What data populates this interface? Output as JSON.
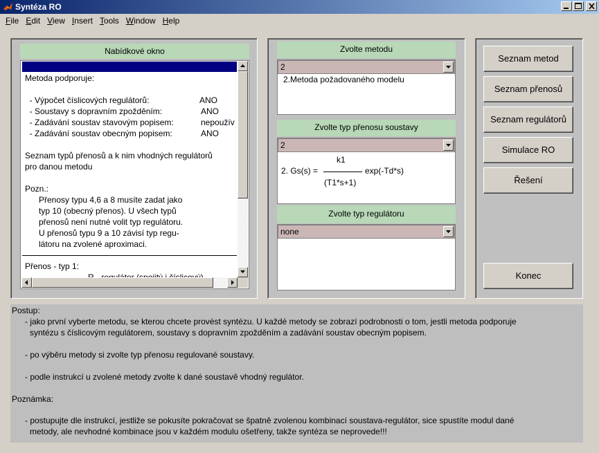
{
  "window": {
    "title": "Syntéza RO"
  },
  "menu": [
    {
      "first": "F",
      "rest": "ile"
    },
    {
      "first": "E",
      "rest": "dit"
    },
    {
      "first": "V",
      "rest": "iew"
    },
    {
      "first": "I",
      "rest": "nsert"
    },
    {
      "first": "T",
      "rest": "ools"
    },
    {
      "first": "W",
      "rest": "indow"
    },
    {
      "first": "H",
      "rest": "elp"
    }
  ],
  "left_panel": {
    "header": "Nabídkové okno",
    "lines": [
      "Metoda podporuje:",
      "",
      "  - Výpočet číslicových regulátorů:",
      "  - Soustavy s dopravním zpožděním:",
      "  - Zadávání soustav stavovým popisem:",
      "  - Zadávání soustav obecným popisem:",
      "",
      "Seznam typů přenosů a k nim vhodných regulátorů",
      "pro danou metodu",
      "",
      "Pozn.:",
      "      Přenosy typu 4,6 a 8 musíte zadat jako",
      "      typ 10 (obecný přenos). U všech typů",
      "      přenosů není nutné volit typ regulátoru.",
      "      U přenosů typu 9 a 10 závisí typ regu-",
      "      látoru na zvolené aproximaci."
    ],
    "values": [
      "ANO",
      "ANO",
      "nepoužív",
      "ANO"
    ],
    "prenos_title": "Přenos - typ 1:",
    "prenos_cut": "R - regulátor (spojitý i číslicový)"
  },
  "middle_panel": {
    "metoda": {
      "header": "Zvolte metodu",
      "selected": "2",
      "item": "2.Metoda požadovaného modelu"
    },
    "prenos": {
      "header": "Zvolte typ přenosu soustavy",
      "selected": "2",
      "numerator": "k1",
      "prefix": "2. Gs(s) =",
      "denominator": "(T1*s+1)",
      "suffix": "exp(-Td*s)"
    },
    "regulator": {
      "header": "Zvolte typ regulátoru",
      "selected": "none"
    }
  },
  "buttons": {
    "seznam_metod": "Seznam metod",
    "seznam_prenosu": "Seznam přenosů",
    "seznam_regulatoru": "Seznam regulátorů",
    "simulace": "Simulace RO",
    "reseni": "Řešení",
    "konec": "Konec"
  },
  "bottom": {
    "postup_title": "Postup:",
    "p1a": "- jako první vyberte metodu, se kterou chcete provést syntézu. U každé metody se zobrazí podrobnosti o tom, jestli metoda podporuje",
    "p1b": "syntézu s číslicovým regulátorem, soustavy s dopravním zpožděním a zadávání soustav obecným popisem.",
    "p2": "- po výběru metody si zvolte typ přenosu regulované soustavy.",
    "p3": "- podle instrukcí u zvolené metody zvolte k dané soustavě vhodný regulátor.",
    "poznamka_title": "Poznámka:",
    "n1a": "- postupujte dle instrukcí, jestliže se pokusíte pokračovat se špatně zvolenou kombinací soustava-regulátor, sice spustíte modul dané",
    "n1b": "metody, ale nevhodné kombinace jsou v každém modulu ošetřeny, takže syntéza se neprovede!!!"
  },
  "colors": {
    "title_start": "#0a246a",
    "title_end": "#a6caf0",
    "header_green": "#b8d8b8",
    "popup_bg": "#cbb6b6",
    "selection": "#000080"
  }
}
